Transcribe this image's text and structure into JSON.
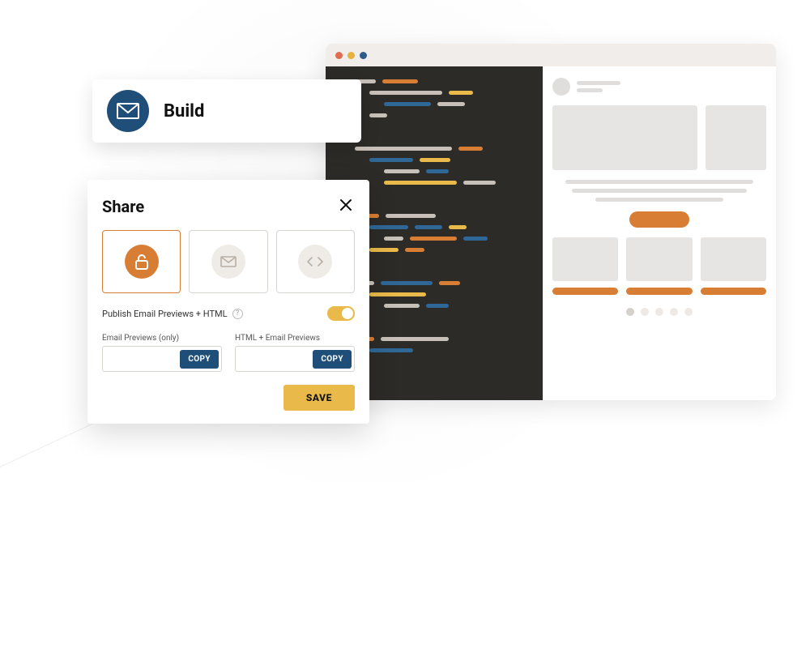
{
  "build": {
    "title": "Build",
    "icon_name": "envelope-icon"
  },
  "share": {
    "title": "Share",
    "close_name": "close-icon",
    "options": [
      {
        "name": "link-option",
        "icon": "unlock-icon",
        "selected": true
      },
      {
        "name": "email-option",
        "icon": "envelope-icon",
        "selected": false
      },
      {
        "name": "code-option",
        "icon": "code-icon",
        "selected": false
      }
    ],
    "publish_label": "Publish Email Previews + HTML",
    "publish_enabled": true,
    "fields": {
      "email_previews_label": "Email Previews (only)",
      "html_previews_label": "HTML + Email Previews",
      "copy_label": "COPY"
    },
    "save_label": "SAVE"
  },
  "browser": {
    "window_dots": [
      "red",
      "yellow",
      "blue"
    ]
  },
  "colors": {
    "orange": "#d87e34",
    "yellow": "#e9b949",
    "navy": "#1f4f78",
    "codebg": "#2c2b28"
  }
}
